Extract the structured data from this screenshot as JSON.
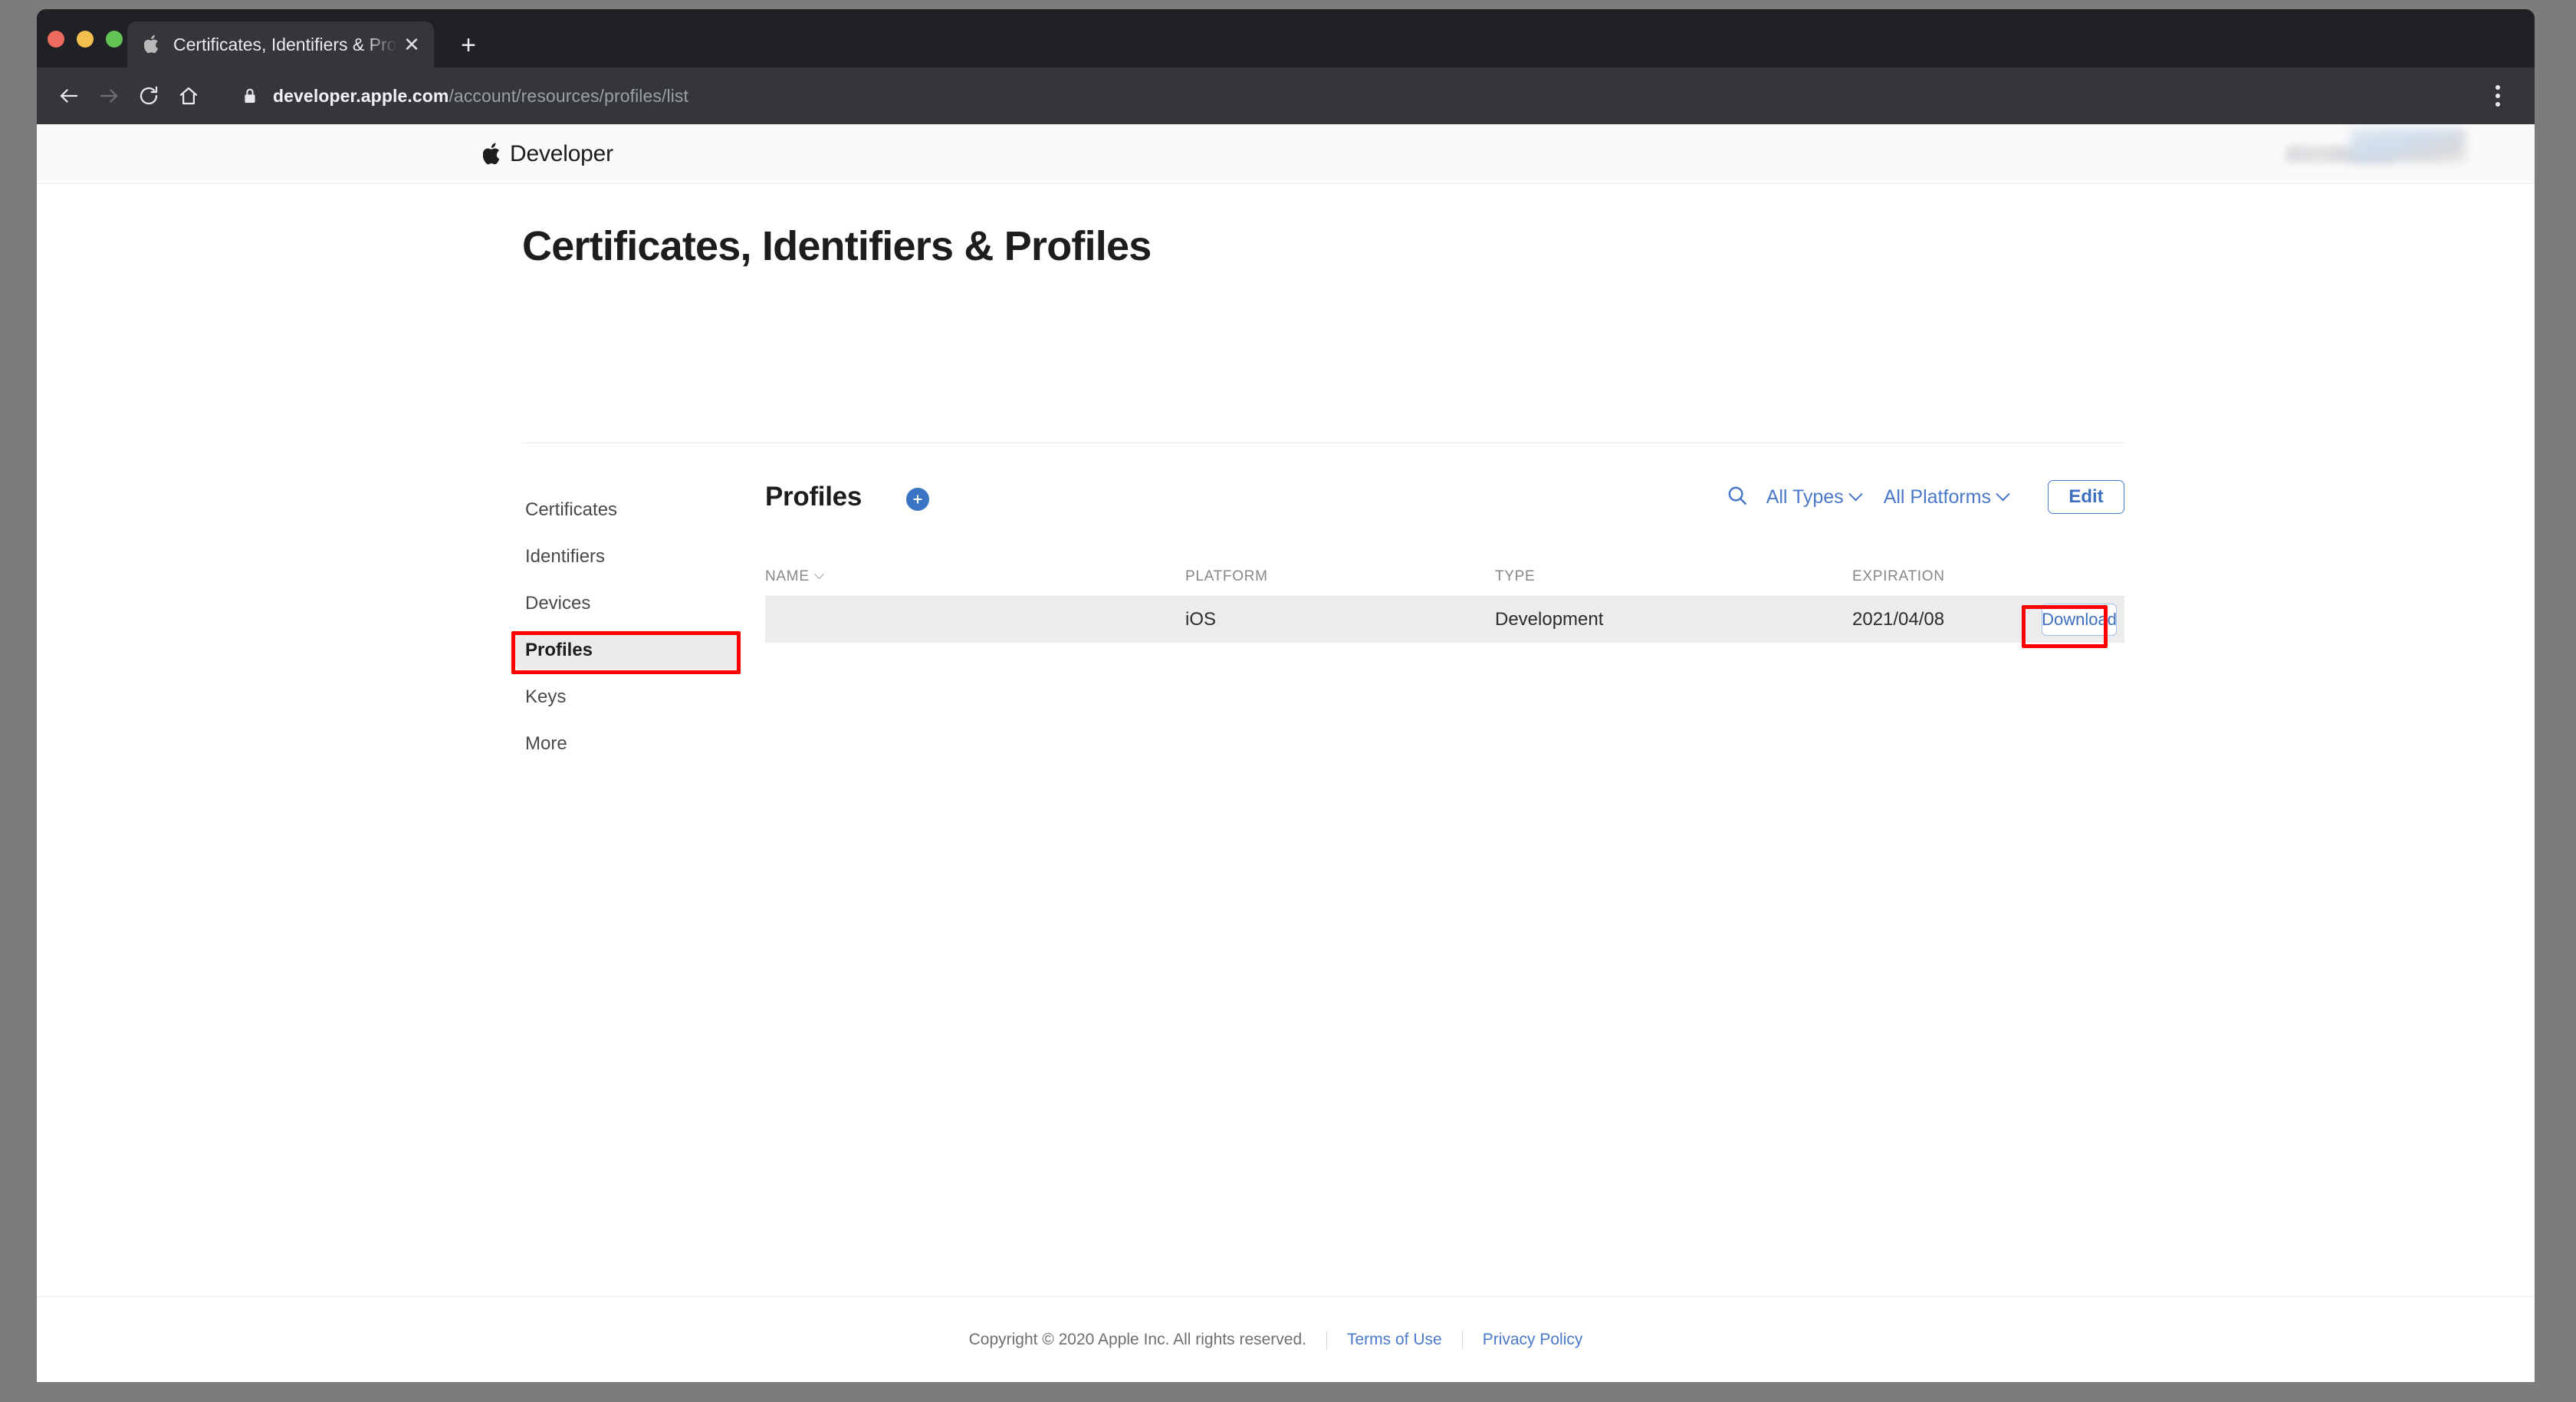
{
  "browser": {
    "tab": {
      "title": "Certificates, Identifiers & Profiles",
      "favicon_icon": "apple-favicon",
      "close_icon": "close-icon"
    },
    "new_tab_icon": "plus-icon",
    "nav": {
      "back_icon": "arrow-left-icon",
      "forward_icon": "arrow-right-icon",
      "reload_icon": "reload-icon",
      "home_icon": "home-icon",
      "menu_icon": "three-dots-vertical-icon"
    },
    "omnibox": {
      "lock_icon": "lock-icon",
      "url_host": "developer.apple.com",
      "url_path": "/account/resources/profiles/list"
    }
  },
  "global_nav": {
    "apple_icon": "apple-logo-icon",
    "brand_word": "Developer"
  },
  "page": {
    "title": "Certificates, Identifiers & Profiles"
  },
  "sidebar": {
    "items": [
      {
        "label": "Certificates",
        "active": false
      },
      {
        "label": "Identifiers",
        "active": false
      },
      {
        "label": "Devices",
        "active": false
      },
      {
        "label": "Profiles",
        "active": true
      },
      {
        "label": "Keys",
        "active": false
      },
      {
        "label": "More",
        "active": false
      }
    ]
  },
  "content": {
    "title": "Profiles",
    "add_icon": "plus-circle-icon",
    "search_icon": "search-icon",
    "filters": [
      {
        "label": "All Types",
        "chevron_icon": "chevron-down-icon"
      },
      {
        "label": "All Platforms",
        "chevron_icon": "chevron-down-icon"
      }
    ],
    "edit_label": "Edit"
  },
  "table": {
    "columns": [
      {
        "key": "name",
        "label": "NAME",
        "sort_icon": "chevron-down-icon"
      },
      {
        "key": "platform",
        "label": "PLATFORM"
      },
      {
        "key": "type",
        "label": "TYPE"
      },
      {
        "key": "expiration",
        "label": "EXPIRATION"
      }
    ],
    "rows": [
      {
        "name": "",
        "name_redacted": true,
        "platform": "iOS",
        "type": "Development",
        "expiration": "2021/04/08",
        "action_label": "Download"
      }
    ]
  },
  "footer": {
    "copyright": "Copyright © 2020 Apple Inc. All rights reserved.",
    "links": [
      "Terms of Use",
      "Privacy Policy"
    ]
  },
  "annotations": {
    "accent_red": "#ff0000",
    "accent_blue": "#4a79c9",
    "highlight_sidebar_target": "Profiles",
    "highlight_action_target": "Download"
  }
}
